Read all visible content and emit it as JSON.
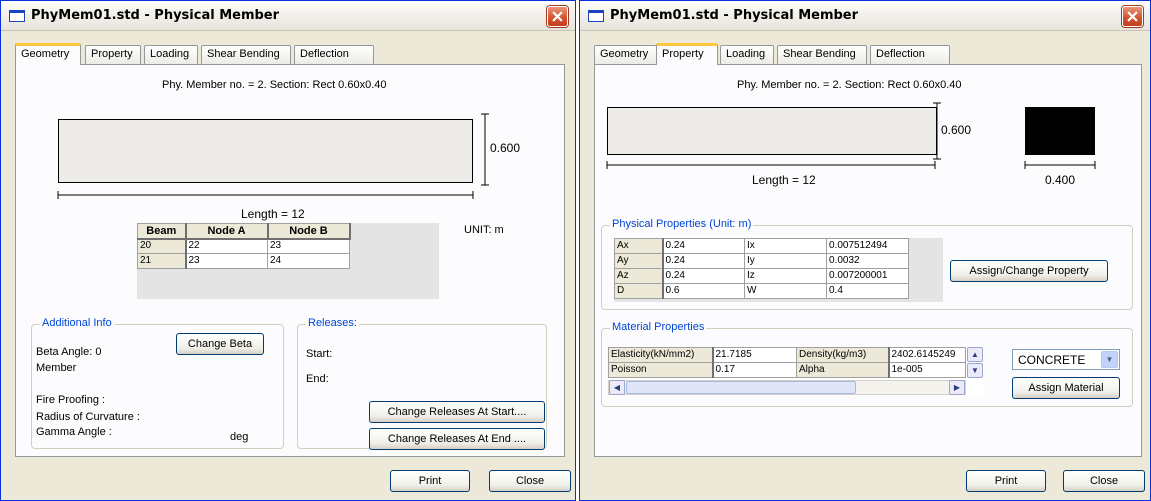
{
  "left": {
    "title": "PhyMem01.std - Physical Member",
    "tabs": [
      "Geometry",
      "Property",
      "Loading",
      "Shear Bending",
      "Deflection"
    ],
    "member_label": "Phy. Member no. = 2. Section: Rect 0.60x0.40",
    "depth_label": "0.600",
    "length_label": "Length = 12",
    "unit_label": "UNIT: m",
    "table": {
      "headers": [
        "Beam",
        "Node A",
        "Node B"
      ],
      "rows": [
        [
          "20",
          "22",
          "23"
        ],
        [
          "21",
          "23",
          "24"
        ]
      ]
    },
    "additional_info": {
      "title": "Additional Info",
      "beta_angle": "Beta Angle:  0",
      "member": "Member",
      "change_beta": "Change Beta",
      "fire_proofing": "Fire Proofing :",
      "radius": "Radius of Curvature :",
      "gamma": "Gamma Angle :",
      "gamma_unit": "deg"
    },
    "releases": {
      "title": "Releases:",
      "start": "Start:",
      "end": "End:",
      "btn_start": "Change Releases At Start....",
      "btn_end": "Change Releases At End ...."
    },
    "print": "Print",
    "close": "Close"
  },
  "right": {
    "title": "PhyMem01.std - Physical Member",
    "tabs": [
      "Geometry",
      "Property",
      "Loading",
      "Shear Bending",
      "Deflection"
    ],
    "member_label": "Phy. Member no. = 2. Section: Rect 0.60x0.40",
    "depth_label": "0.600",
    "length_label": "Length = 12",
    "width_label": "0.400",
    "phys_title": "Physical Properties (Unit: m)",
    "phys_rows": [
      [
        "Ax",
        "0.24",
        "Ix",
        "0.007512494"
      ],
      [
        "Ay",
        "0.24",
        "Iy",
        "0.0032"
      ],
      [
        "Az",
        "0.24",
        "Iz",
        "0.007200001"
      ],
      [
        "D",
        "0.6",
        "W",
        "0.4"
      ]
    ],
    "assign_property": "Assign/Change Property",
    "mat_title": "Material Properties",
    "mat_rows": [
      [
        "Elasticity(kN/mm2)",
        "21.7185",
        "Density(kg/m3)",
        "2402.6145249"
      ],
      [
        "Poisson",
        "0.17",
        "Alpha",
        "1e-005"
      ]
    ],
    "material_select": "CONCRETE",
    "assign_material": "Assign Material",
    "print": "Print",
    "close": "Close"
  }
}
